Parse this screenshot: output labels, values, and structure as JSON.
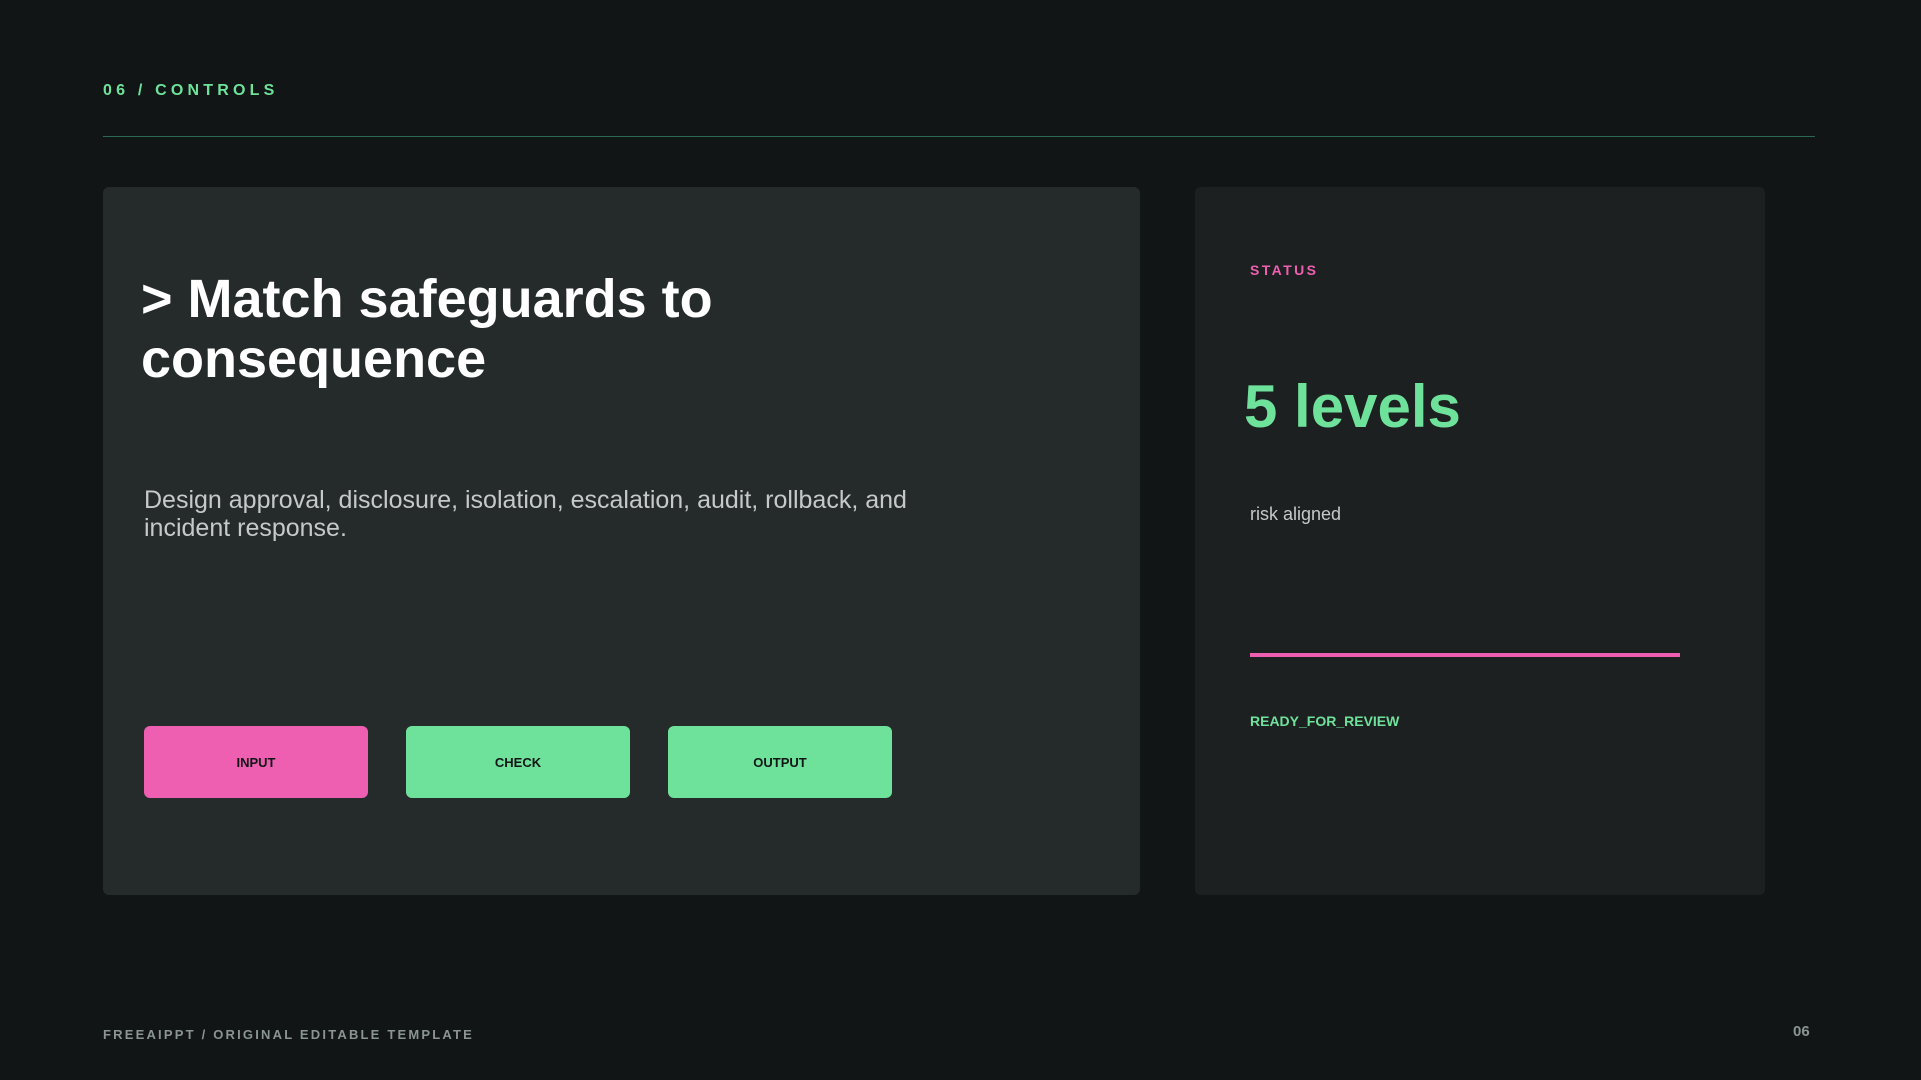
{
  "header": {
    "section_label": "06 / CONTROLS"
  },
  "main_card": {
    "headline": "> Match safeguards to consequence",
    "body": "Design approval, disclosure, isolation, escalation, audit, rollback, and incident response.",
    "buttons": [
      {
        "label": "INPUT",
        "color": "#ef5fb1"
      },
      {
        "label": "CHECK",
        "color": "#6ee29a"
      },
      {
        "label": "OUTPUT",
        "color": "#6ee29a"
      }
    ]
  },
  "status_card": {
    "label": "STATUS",
    "value": "5 levels",
    "caption": "risk aligned",
    "progress_fraction": 1.0,
    "flag": "READY_FOR_REVIEW"
  },
  "footer": {
    "label": "FREEAIPPT / ORIGINAL EDITABLE TEMPLATE",
    "page_number": "06"
  },
  "colors": {
    "background": "#111516",
    "accent_green": "#6ee29a",
    "accent_pink": "#ef5fb1",
    "card": "#252a2b",
    "status_card": "#1c2021"
  }
}
